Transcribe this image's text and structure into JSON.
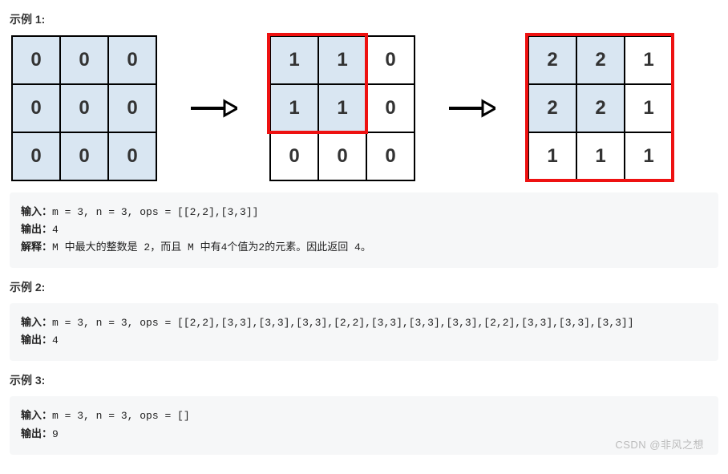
{
  "example1": {
    "title": "示例 1:",
    "grid1": [
      [
        "0",
        "0",
        "0"
      ],
      [
        "0",
        "0",
        "0"
      ],
      [
        "0",
        "0",
        "0"
      ]
    ],
    "grid2": [
      [
        "1",
        "1",
        "0"
      ],
      [
        "1",
        "1",
        "0"
      ],
      [
        "0",
        "0",
        "0"
      ]
    ],
    "grid3": [
      [
        "2",
        "2",
        "1"
      ],
      [
        "2",
        "2",
        "1"
      ],
      [
        "1",
        "1",
        "1"
      ]
    ],
    "code": {
      "label_input": "输入：",
      "input": "m = 3, n = 3, ops = [[2,2],[3,3]]",
      "label_output": "输出：",
      "output": "4",
      "label_explain": "解释：",
      "explain": "M 中最大的整数是 2，而且 M 中有4个值为2的元素。因此返回 4。"
    }
  },
  "example2": {
    "title": "示例 2:",
    "code": {
      "label_input": "输入：",
      "input": "m = 3, n = 3, ops = [[2,2],[3,3],[3,3],[3,3],[2,2],[3,3],[3,3],[3,3],[2,2],[3,3],[3,3],[3,3]]",
      "label_output": "输出：",
      "output": "4"
    }
  },
  "example3": {
    "title": "示例 3:",
    "code": {
      "label_input": "输入：",
      "input": "m = 3, n = 3, ops = []",
      "label_output": "输出：",
      "output": "9"
    }
  },
  "watermark": "CSDN @非风之想"
}
